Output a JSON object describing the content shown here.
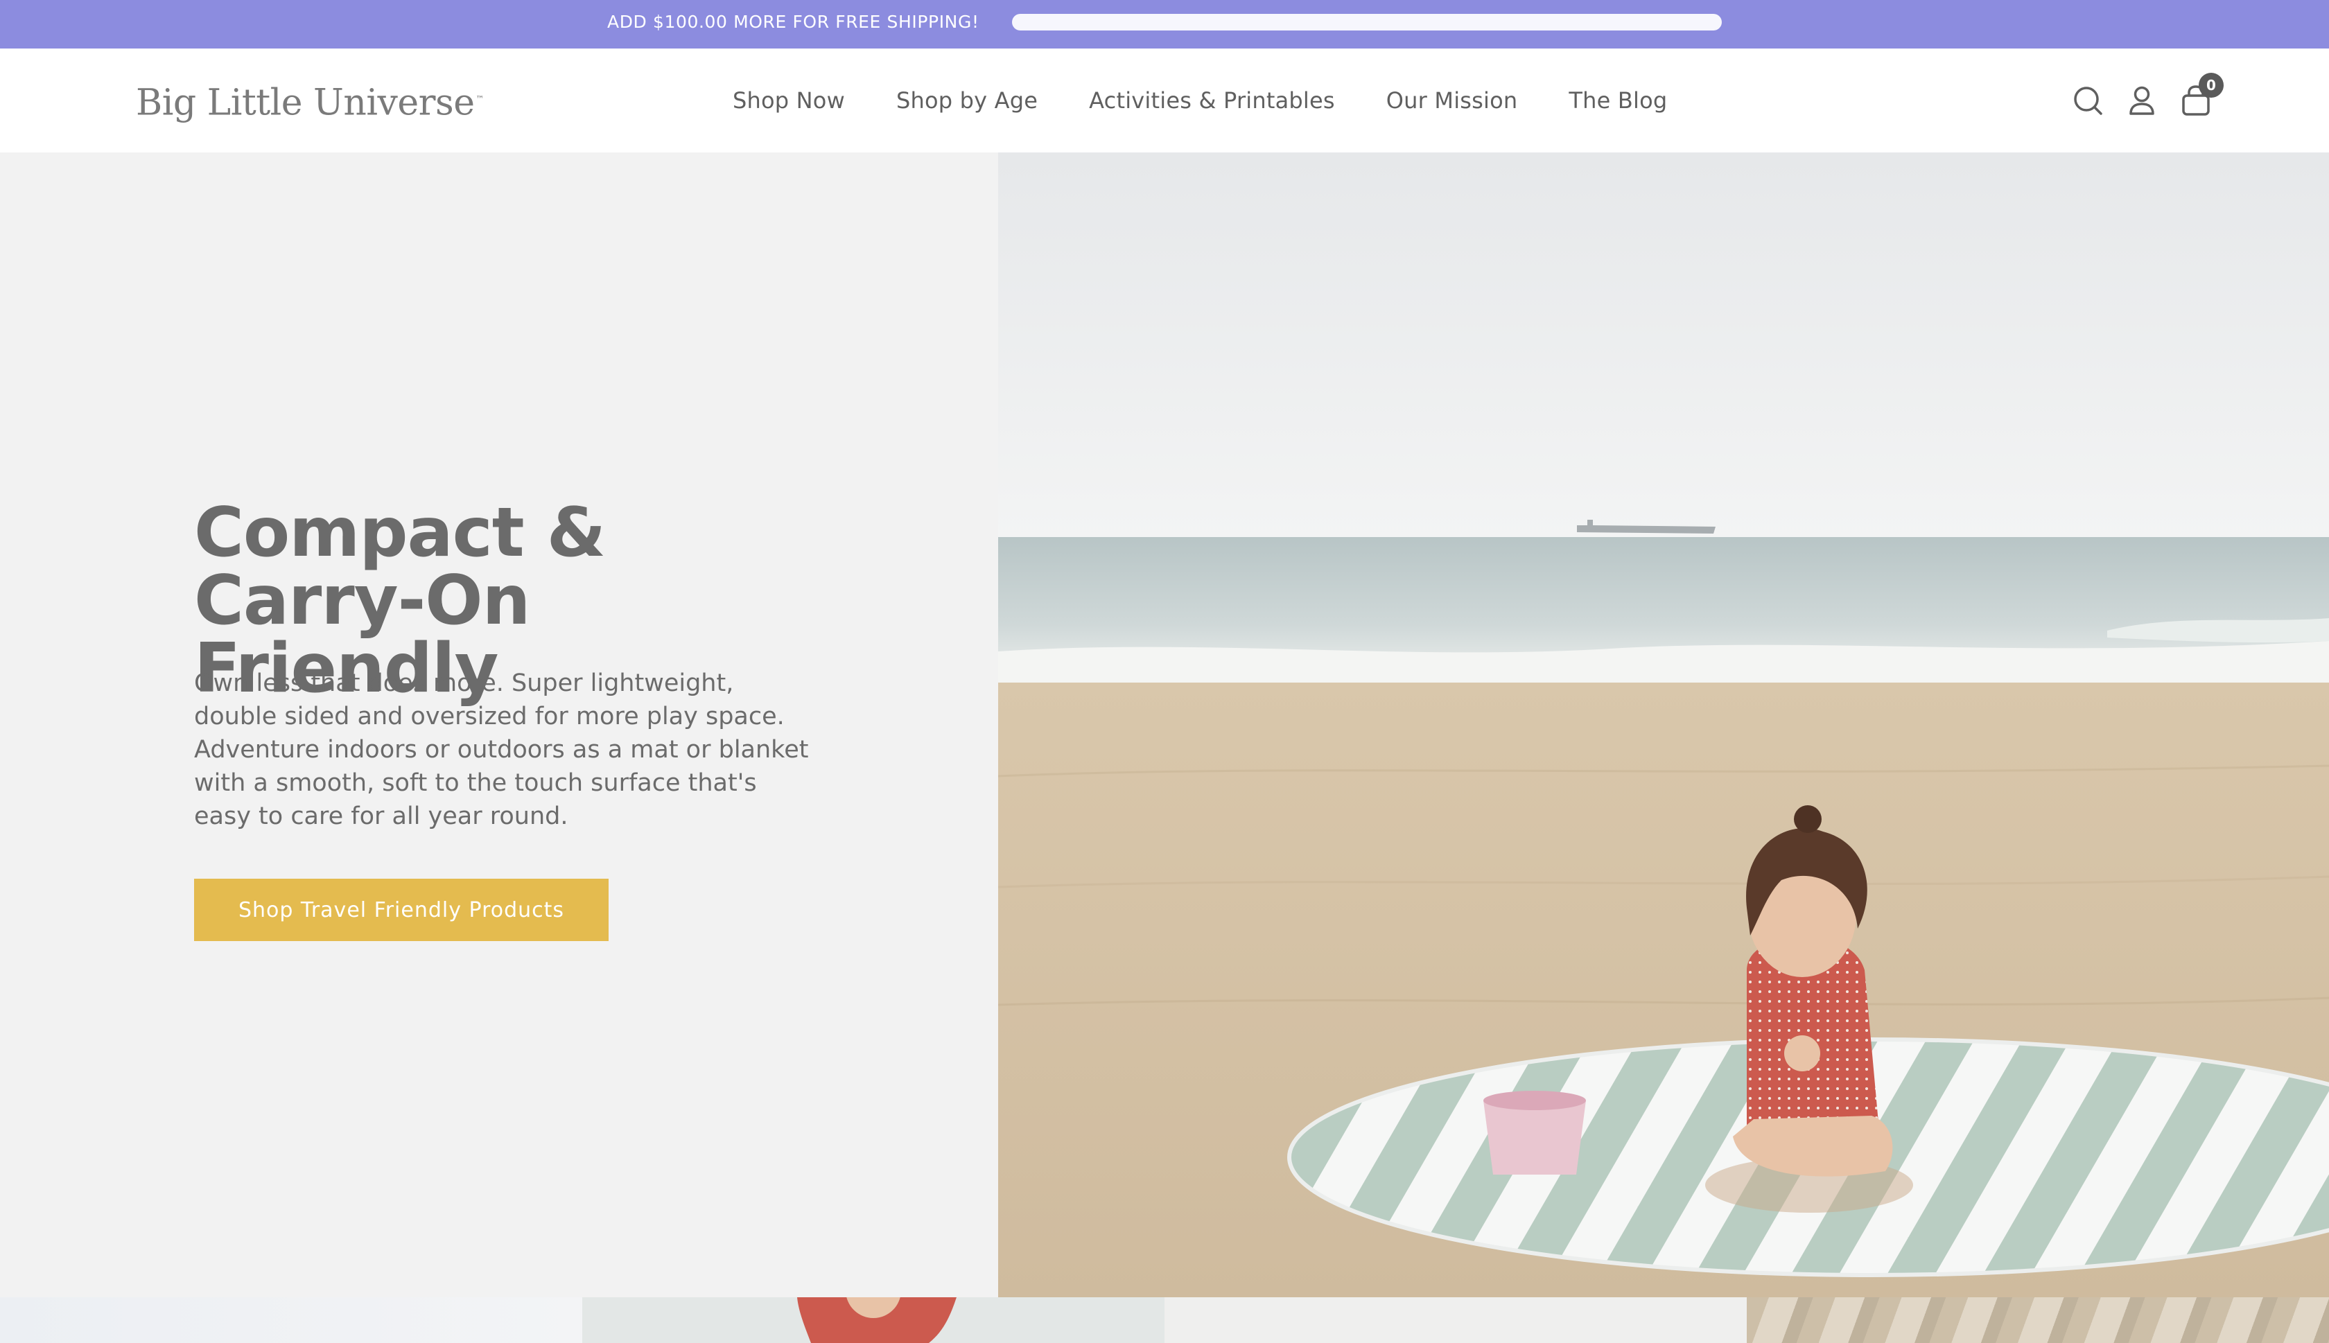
{
  "announcement": {
    "text": "ADD $100.00 MORE FOR FREE SHIPPING!",
    "progress_fraction": 0.0
  },
  "header": {
    "logo_text": "Big Little Universe",
    "logo_tm": "™",
    "nav": [
      {
        "label": "Shop Now"
      },
      {
        "label": "Shop by Age"
      },
      {
        "label": "Activities & Printables"
      },
      {
        "label": "Our Mission"
      },
      {
        "label": "The Blog"
      }
    ],
    "icons": [
      "search-icon",
      "account-icon",
      "cart-icon"
    ],
    "cart_count": "0"
  },
  "hero": {
    "title": "Compact & Carry-On Friendly",
    "description": "Own less that does more. Super lightweight, double sided and oversized for more play space. Adventure indoors or outdoors as a mat or blanket with a smooth, soft to the touch surface that's easy to care for all year round.",
    "cta_label": "Shop Travel Friendly Products",
    "image_subject": "toddler-on-beach-mat"
  },
  "colors": {
    "announcement_bg": "#8c8cdf",
    "cta_bg": "#e4bb4f",
    "hero_left_bg": "#f2f2f2",
    "text": "#6b6b6b"
  }
}
